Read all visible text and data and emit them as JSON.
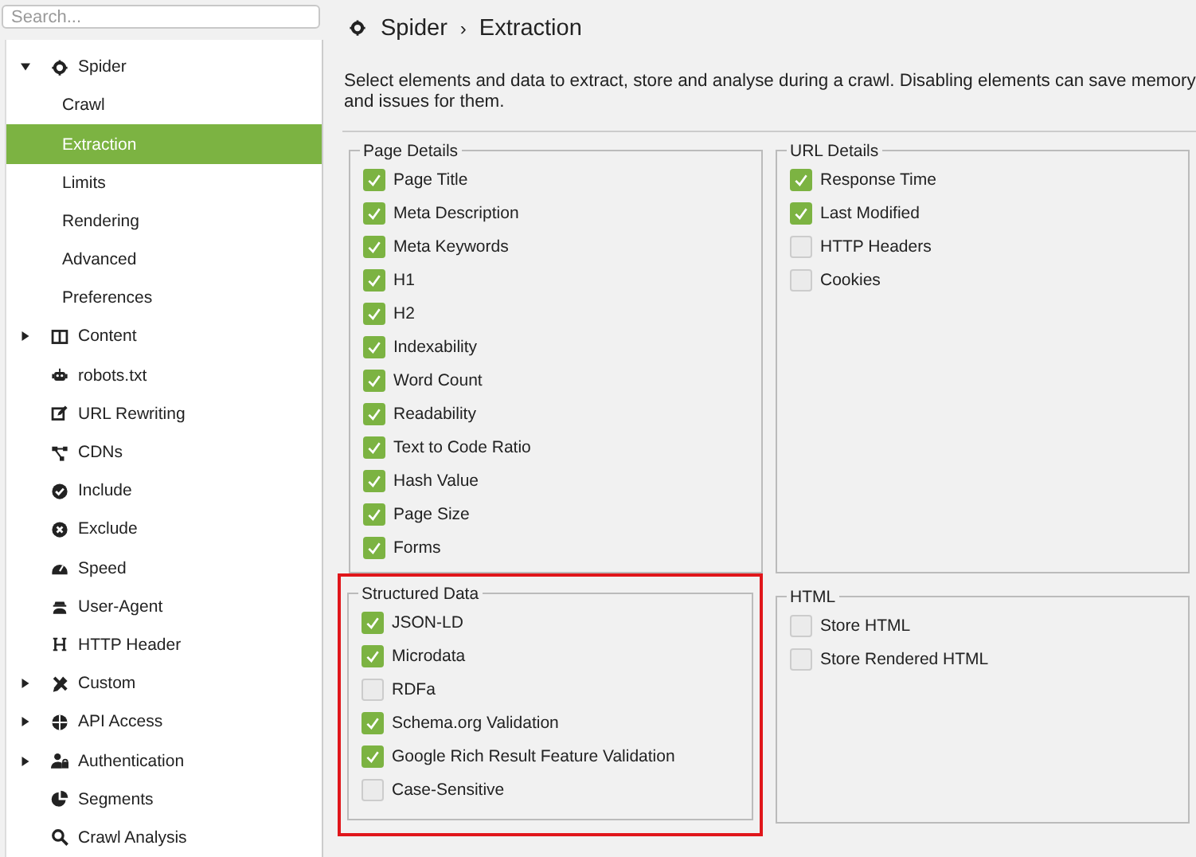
{
  "sidebar": {
    "search": {
      "placeholder": "Search..."
    },
    "items": [
      {
        "label": "Spider",
        "expanded": true,
        "children": [
          {
            "label": "Crawl",
            "selected": false
          },
          {
            "label": "Extraction",
            "selected": true
          },
          {
            "label": "Limits",
            "selected": false
          },
          {
            "label": "Rendering",
            "selected": false
          },
          {
            "label": "Advanced",
            "selected": false
          },
          {
            "label": "Preferences",
            "selected": false
          }
        ]
      },
      {
        "label": "Content",
        "expanded": false
      },
      {
        "label": "robots.txt"
      },
      {
        "label": "URL Rewriting"
      },
      {
        "label": "CDNs"
      },
      {
        "label": "Include"
      },
      {
        "label": "Exclude"
      },
      {
        "label": "Speed"
      },
      {
        "label": "User-Agent"
      },
      {
        "label": "HTTP Header"
      },
      {
        "label": "Custom",
        "expanded": false
      },
      {
        "label": "API Access",
        "expanded": false
      },
      {
        "label": "Authentication",
        "expanded": false
      },
      {
        "label": "Segments"
      },
      {
        "label": "Crawl Analysis"
      }
    ]
  },
  "header": {
    "breadcrumb": [
      "Spider",
      "Extraction"
    ],
    "separator": "›"
  },
  "description_lines": [
    "Select elements and data to extract, store and analyse during a crawl. Disabling elements can save memory",
    "and issues for them."
  ],
  "groups": [
    {
      "title": "Page Details",
      "highlighted": false,
      "options": [
        {
          "label": "Page Title",
          "checked": true
        },
        {
          "label": "Meta Description",
          "checked": true
        },
        {
          "label": "Meta Keywords",
          "checked": true
        },
        {
          "label": "H1",
          "checked": true
        },
        {
          "label": "H2",
          "checked": true
        },
        {
          "label": "Indexability",
          "checked": true
        },
        {
          "label": "Word Count",
          "checked": true
        },
        {
          "label": "Readability",
          "checked": true
        },
        {
          "label": "Text to Code Ratio",
          "checked": true
        },
        {
          "label": "Hash Value",
          "checked": true
        },
        {
          "label": "Page Size",
          "checked": true
        },
        {
          "label": "Forms",
          "checked": true
        }
      ]
    },
    {
      "title": "URL Details",
      "highlighted": false,
      "options": [
        {
          "label": "Response Time",
          "checked": true
        },
        {
          "label": "Last Modified",
          "checked": true
        },
        {
          "label": "HTTP Headers",
          "checked": false
        },
        {
          "label": "Cookies",
          "checked": false
        }
      ]
    },
    {
      "title": "Structured Data",
      "highlighted": true,
      "options": [
        {
          "label": "JSON-LD",
          "checked": true
        },
        {
          "label": "Microdata",
          "checked": true
        },
        {
          "label": "RDFa",
          "checked": false
        },
        {
          "label": "Schema.org Validation",
          "checked": true
        },
        {
          "label": "Google Rich Result Feature Validation",
          "checked": true
        },
        {
          "label": "Case-Sensitive",
          "checked": false
        }
      ]
    },
    {
      "title": "HTML",
      "highlighted": false,
      "options": [
        {
          "label": "Store HTML",
          "checked": false
        },
        {
          "label": "Store Rendered HTML",
          "checked": false
        }
      ]
    }
  ]
}
